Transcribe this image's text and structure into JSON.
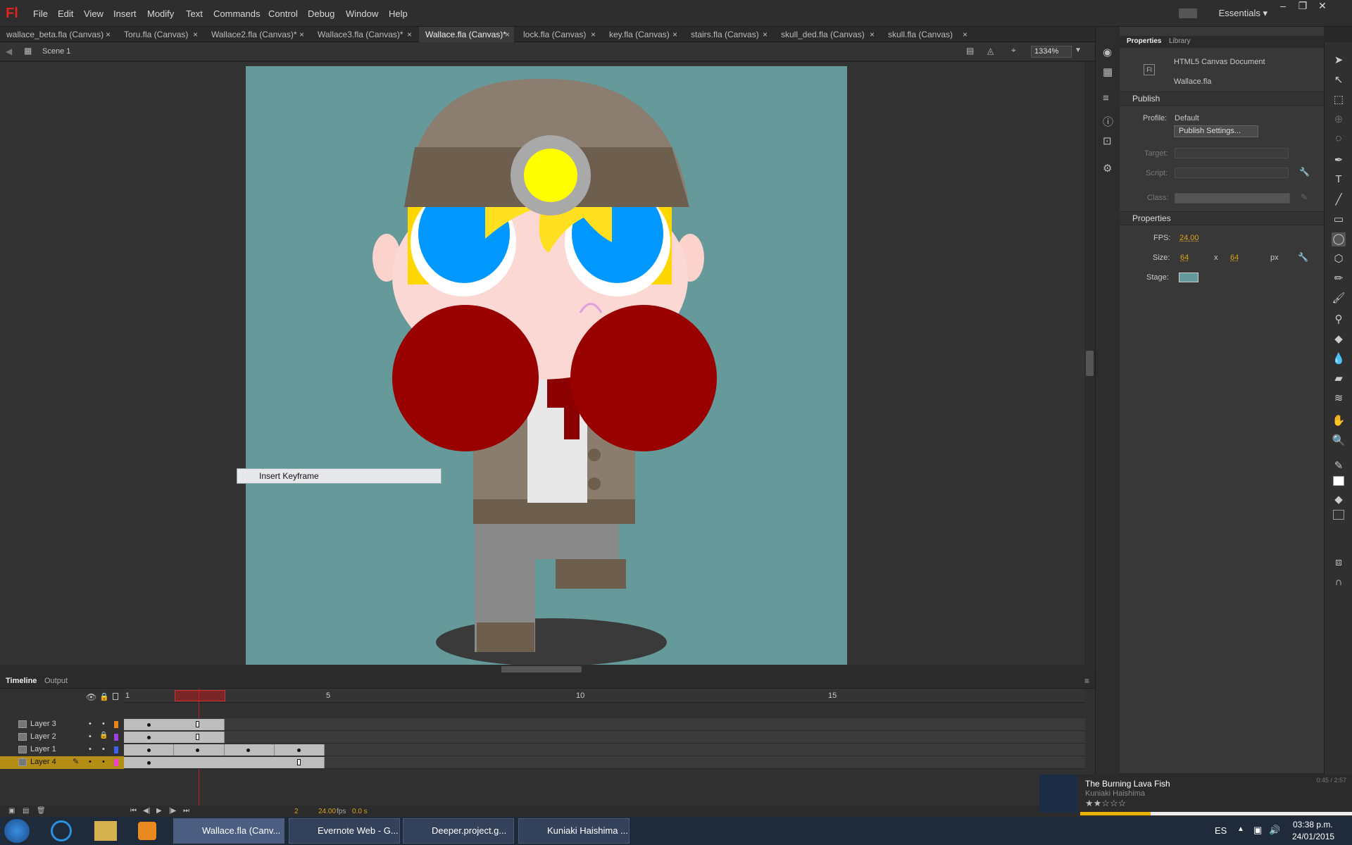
{
  "app": {
    "logo": "Fl",
    "menu": [
      "File",
      "Edit",
      "View",
      "Insert",
      "Modify",
      "Text",
      "Commands",
      "Control",
      "Debug",
      "Window",
      "Help"
    ],
    "workspace": "Essentials"
  },
  "doc_tabs": [
    {
      "label": "wallace_beta.fla (Canvas)",
      "active": false
    },
    {
      "label": "Toru.fla (Canvas)",
      "active": false
    },
    {
      "label": "Wallace2.fla (Canvas)*",
      "active": false
    },
    {
      "label": "Wallace3.fla (Canvas)*",
      "active": false
    },
    {
      "label": "Wallace.fla (Canvas)*",
      "active": true
    },
    {
      "label": "lock.fla (Canvas)",
      "active": false
    },
    {
      "label": "key.fla (Canvas)",
      "active": false
    },
    {
      "label": "stairs.fla (Canvas)",
      "active": false
    },
    {
      "label": "skull_ded.fla (Canvas)",
      "active": false
    },
    {
      "label": "skull.fla (Canvas)",
      "active": false
    }
  ],
  "scene": {
    "name": "Scene 1",
    "zoom": "1334%"
  },
  "stage": {
    "color": "#669999"
  },
  "context_menu": {
    "item": "Insert Keyframe"
  },
  "timeline": {
    "tabs": [
      "Timeline",
      "Output"
    ],
    "ruler_labels": [
      "1",
      "5",
      "10",
      "15"
    ],
    "layers": [
      {
        "name": "Layer 3",
        "color": "#e8841a",
        "locked": false,
        "selected": false
      },
      {
        "name": "Layer 2",
        "color": "#a040e0",
        "locked": true,
        "selected": false
      },
      {
        "name": "Layer 1",
        "color": "#4060f0",
        "locked": false,
        "selected": false
      },
      {
        "name": "Layer 4",
        "color": "#f040d0",
        "locked": false,
        "selected": true
      }
    ],
    "current_frame": "2",
    "fps": "24.00",
    "fps_unit": "fps",
    "time": "0.0 s"
  },
  "properties_panel": {
    "tabs": [
      "Properties",
      "Library"
    ],
    "doc_type": "HTML5 Canvas Document",
    "file_name": "Wallace.fla",
    "publish": {
      "header": "Publish",
      "profile_label": "Profile:",
      "profile_value": "Default",
      "settings_button": "Publish Settings...",
      "target_label": "Target:",
      "script_label": "Script:",
      "class_label": "Class:"
    },
    "properties": {
      "header": "Properties",
      "fps_label": "FPS:",
      "fps_value": "24.00",
      "size_label": "Size:",
      "width": "64",
      "x": "x",
      "height": "64",
      "unit": "px",
      "stage_label": "Stage:",
      "stage_color": "#669999"
    }
  },
  "music": {
    "title": "The Burning Lava Fish",
    "artist": "Kuniaki Haishima",
    "time": "0:45 / 2:57",
    "progress": 0.26
  },
  "taskbar": {
    "buttons": [
      {
        "label": "Wallace.fla (Canv...",
        "active": true
      },
      {
        "label": "Evernote Web - G...",
        "active": false
      },
      {
        "label": "Deeper.project.g...",
        "active": false
      },
      {
        "label": "Kuniaki Haishima ...",
        "active": false
      }
    ],
    "lang": "ES",
    "clock_time": "03:38 p.m.",
    "clock_date": "24/01/2015"
  }
}
